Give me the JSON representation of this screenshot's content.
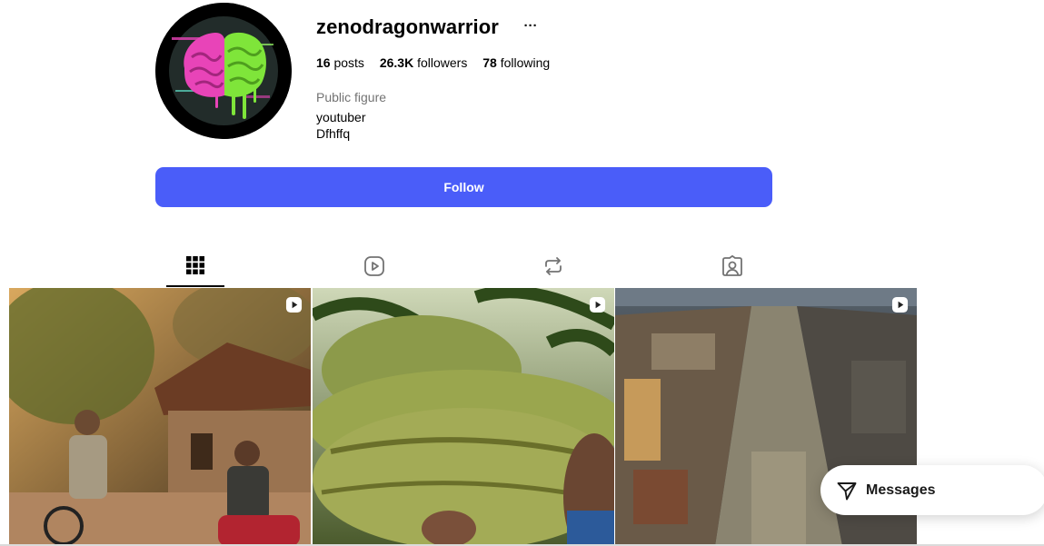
{
  "profile": {
    "username": "zenodragonwarrior",
    "more_label": "···",
    "stats": {
      "posts_count": "16",
      "posts_label": "posts",
      "followers_count": "26.3K",
      "followers_label": "followers",
      "following_count": "78",
      "following_label": "following"
    },
    "category": "Public figure",
    "bio_line1": "youtuber",
    "bio_line2": "Dfhffq",
    "follow_label": "Follow"
  },
  "tabs": [
    {
      "name": "posts",
      "icon": "grid-icon",
      "active": true
    },
    {
      "name": "reels",
      "icon": "reels-icon",
      "active": false
    },
    {
      "name": "reposts",
      "icon": "repost-icon",
      "active": false
    },
    {
      "name": "tagged",
      "icon": "tagged-icon",
      "active": false
    }
  ],
  "posts": [
    {
      "type": "reel",
      "scene": "elderly man on bicycle and young man on motorbike in village"
    },
    {
      "type": "reel",
      "scene": "woven straw hat among palm trees"
    },
    {
      "type": "reel",
      "scene": "aerial view of city boulevard"
    }
  ],
  "messages": {
    "label": "Messages",
    "icon": "paper-plane-icon"
  },
  "colors": {
    "follow_button": "#4a5df9",
    "secondary_text": "#737373",
    "avatar_pink": "#e844b8",
    "avatar_green": "#7fe53a"
  }
}
